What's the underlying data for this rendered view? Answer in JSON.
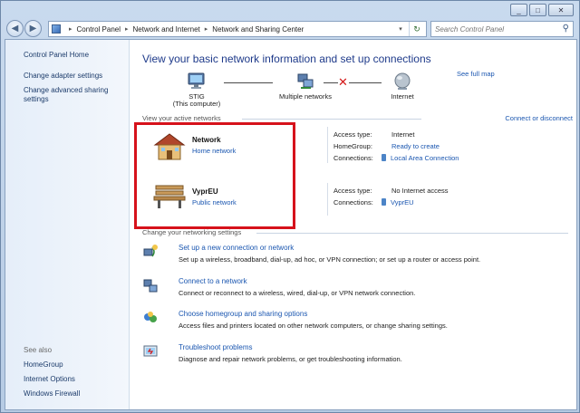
{
  "window": {
    "controls": [
      "_",
      "□",
      "✕"
    ]
  },
  "address_bar": {
    "crumbs": [
      "Control Panel",
      "Network and Internet",
      "Network and Sharing Center"
    ],
    "refresh_symbol": "↻",
    "dropdown_symbol": "▾"
  },
  "search": {
    "placeholder": "Search Control Panel"
  },
  "sidebar": {
    "home": "Control Panel Home",
    "links": [
      "Change adapter settings",
      "Change advanced sharing settings"
    ],
    "see_also_label": "See also",
    "see_also": [
      "HomeGroup",
      "Internet Options",
      "Windows Firewall"
    ]
  },
  "main": {
    "heading": "View your basic network information and set up connections",
    "see_full_map": "See full map",
    "map": {
      "computer_name": "STIG",
      "computer_sub": "(This computer)",
      "networks_label": "Multiple networks",
      "internet_label": "Internet"
    },
    "active_networks_label": "View your active networks",
    "connect_or_disconnect": "Connect or disconnect",
    "networks": [
      {
        "name": "Network",
        "type": "Home network",
        "access_type_label": "Access type:",
        "access_type": "Internet",
        "homegroup_label": "HomeGroup:",
        "homegroup": "Ready to create",
        "connections_label": "Connections:",
        "connection": "Local Area Connection"
      },
      {
        "name": "VyprEU",
        "type": "Public network",
        "access_type_label": "Access type:",
        "access_type": "No Internet access",
        "connections_label": "Connections:",
        "connection": "VyprEU"
      }
    ],
    "change_settings_label": "Change your networking settings",
    "tasks": [
      {
        "title": "Set up a new connection or network",
        "desc": "Set up a wireless, broadband, dial-up, ad hoc, or VPN connection; or set up a router or access point."
      },
      {
        "title": "Connect to a network",
        "desc": "Connect or reconnect to a wireless, wired, dial-up, or VPN network connection."
      },
      {
        "title": "Choose homegroup and sharing options",
        "desc": "Access files and printers located on other network computers, or change sharing settings."
      },
      {
        "title": "Troubleshoot problems",
        "desc": "Diagnose and repair network problems, or get troubleshooting information."
      }
    ]
  },
  "colors": {
    "link": "#1a56b0",
    "heading": "#1e3a8a",
    "highlight_box": "#d6121b"
  }
}
